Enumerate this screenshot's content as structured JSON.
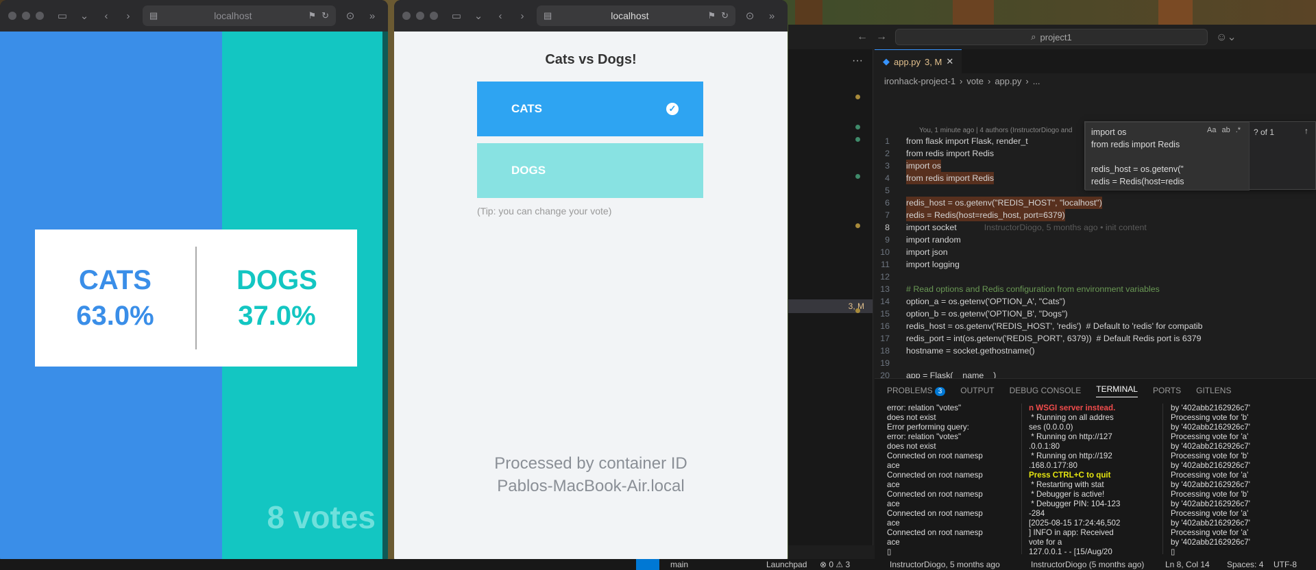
{
  "browser_left": {
    "url": "localhost"
  },
  "browser_right": {
    "url": "localhost"
  },
  "result_page": {
    "option_a": {
      "name": "CATS",
      "percent": "63.0%"
    },
    "option_b": {
      "name": "DOGS",
      "percent": "37.0%"
    },
    "votes": "8 votes",
    "share_a": 0.63
  },
  "vote_page": {
    "title": "Cats vs Dogs!",
    "option_a": "CATS",
    "option_b": "DOGS",
    "tip": "(Tip: you can change your vote)",
    "processed_line1": "Processed by container ID",
    "processed_line2": "Pablos-MacBook-Air.local"
  },
  "vscode": {
    "search": "project1",
    "tab": {
      "file": "app.py",
      "status": "3, M"
    },
    "breadcrumb": [
      "ironhack-project-1",
      "vote",
      "app.py",
      "..."
    ],
    "sidebar_badge": "3, M",
    "blame_header": "You, 1 minute ago | 4 authors (InstructorDiogo and",
    "inline_blame": "InstructorDiogo, 5 months ago • init content",
    "find": {
      "text": "import os\nfrom redis import Redis\n\nredis_host = os.getenv(\"\nredis = Redis(host=redis",
      "count": "? of 1",
      "options": [
        "Aa",
        "ab",
        ".*"
      ]
    },
    "code": [
      {
        "n": "1",
        "t": "from flask import Flask, render_t"
      },
      {
        "n": "2",
        "t": "from redis import Redis"
      },
      {
        "n": "3",
        "t": "import os"
      },
      {
        "n": "4",
        "t": "from redis import Redis"
      },
      {
        "n": "5",
        "t": ""
      },
      {
        "n": "6",
        "t": "redis_host = os.getenv(\"REDIS_HOST\", \"localhost\")"
      },
      {
        "n": "7",
        "t": "redis = Redis(host=redis_host, port=6379)"
      },
      {
        "n": "8",
        "t": "import socket"
      },
      {
        "n": "9",
        "t": "import random"
      },
      {
        "n": "10",
        "t": "import json"
      },
      {
        "n": "11",
        "t": "import logging"
      },
      {
        "n": "12",
        "t": ""
      },
      {
        "n": "13",
        "t": "# Read options and Redis configuration from environment variables"
      },
      {
        "n": "14",
        "t": "option_a = os.getenv('OPTION_A', \"Cats\")"
      },
      {
        "n": "15",
        "t": "option_b = os.getenv('OPTION_B', \"Dogs\")"
      },
      {
        "n": "16",
        "t": "redis_host = os.getenv('REDIS_HOST', 'redis')  # Default to 'redis' for compatib"
      },
      {
        "n": "17",
        "t": "redis_port = int(os.getenv('REDIS_PORT', 6379))  # Default Redis port is 6379"
      },
      {
        "n": "18",
        "t": "hostname = socket.gethostname()"
      },
      {
        "n": "19",
        "t": ""
      },
      {
        "n": "20",
        "t": "app = Flask(__name__)"
      }
    ],
    "panel_tabs": [
      "PROBLEMS",
      "OUTPUT",
      "DEBUG CONSOLE",
      "TERMINAL",
      "PORTS",
      "GITLENS"
    ],
    "problems_count": "3",
    "terminal_1": "error: relation \"votes\"\ndoes not exist\nError performing query:\nerror: relation \"votes\"\ndoes not exist\nConnected on root namesp\nace\nConnected on root namesp\nace\nConnected on root namesp\nace\nConnected on root namesp\nace\nConnected on root namesp\nace\n▯",
    "terminal_2_warn": "n WSGI server instead.",
    "terminal_2a": " * Running on all addres\nses (0.0.0.0)\n * Running on http://127\n.0.0.1:80\n * Running on http://192\n.168.0.177:80",
    "terminal_2_quit": "Press CTRL+C to quit",
    "terminal_2b": " * Restarting with stat\n * Debugger is active!\n * Debugger PIN: 104-123\n-284\n[2025-08-15 17:24:46,502\n] INFO in app: Received\nvote for a\n127.0.0.1 - - [15/Aug/20",
    "terminal_3": "by '402abb2162926c7'\nProcessing vote for 'b'\nby '402abb2162926c7'\nProcessing vote for 'a'\nby '402abb2162926c7'\nProcessing vote for 'b'\nby '402abb2162926c7'\nProcessing vote for 'a'\nby '402abb2162926c7'\nProcessing vote for 'b'\nby '402abb2162926c7'\nProcessing vote for 'a'\nby '402abb2162926c7'\nProcessing vote for 'a'\nby '402abb2162926c7'\n▯",
    "status": {
      "branch": "main",
      "launchpad": "Launchpad",
      "errors": "⊗ 0 ⚠ 3",
      "blame1": "InstructorDiogo, 5 months ago",
      "blame2": "InstructorDiogo (5 months ago)",
      "cursor": "Ln 8, Col 14",
      "spaces": "Spaces: 4",
      "encoding": "UTF-8"
    }
  }
}
